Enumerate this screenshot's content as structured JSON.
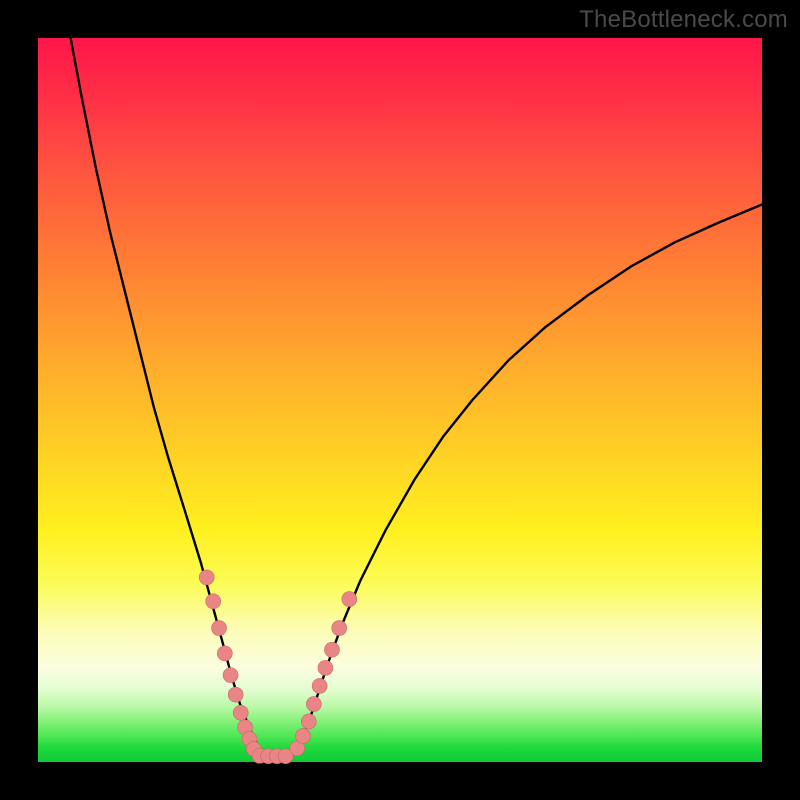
{
  "watermark": "TheBottleneck.com",
  "colors": {
    "dot_fill": "#e98585",
    "dot_stroke": "#c76969",
    "line": "#000000"
  },
  "chart_data": {
    "type": "line",
    "title": "",
    "xlabel": "",
    "ylabel": "",
    "xlim": [
      0,
      100
    ],
    "ylim": [
      0,
      100
    ],
    "x": [
      4.5,
      6,
      8,
      10,
      12,
      14,
      16,
      18,
      20.5,
      22.5,
      24,
      25.5,
      26.7,
      27.9,
      29.3,
      30.5,
      31.5,
      34.5,
      36,
      37.4,
      38.7,
      40,
      42,
      44.5,
      48,
      52,
      56,
      60,
      65,
      70,
      76,
      82,
      88,
      94,
      100
    ],
    "y": [
      100,
      92,
      82,
      73,
      65,
      57,
      49,
      42,
      34,
      27.5,
      22,
      16.5,
      12,
      8,
      4.5,
      2,
      0.8,
      0.8,
      2.3,
      5.5,
      9.5,
      13.5,
      19,
      25,
      32,
      39,
      45,
      50,
      55.5,
      60,
      64.5,
      68.5,
      71.8,
      74.5,
      77
    ],
    "dots_left": {
      "x": [
        23.3,
        24.2,
        25.0,
        25.8,
        26.6,
        27.3,
        28.0,
        28.6,
        29.2,
        29.8
      ],
      "y": [
        25.5,
        22.2,
        18.5,
        15.0,
        12.0,
        9.3,
        6.8,
        4.8,
        3.2,
        1.8
      ]
    },
    "dots_bottom": {
      "x": [
        30.6,
        31.8,
        33.0,
        34.2
      ],
      "y": [
        0.85,
        0.8,
        0.8,
        0.8
      ]
    },
    "dots_right": {
      "x": [
        35.8,
        36.6,
        37.4,
        38.1,
        38.9,
        39.7,
        40.6,
        41.6,
        43.0
      ],
      "y": [
        1.9,
        3.6,
        5.6,
        8.0,
        10.5,
        13.0,
        15.5,
        18.5,
        22.5
      ]
    }
  }
}
